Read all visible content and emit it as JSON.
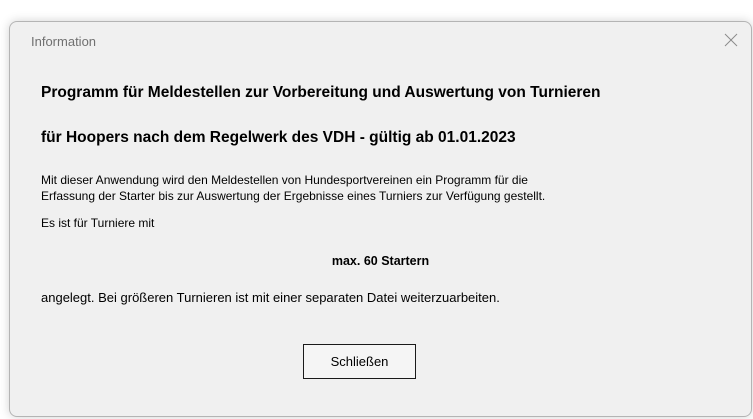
{
  "window": {
    "title": "Information",
    "close_icon": "close-icon"
  },
  "content": {
    "heading_line1": "Programm für Meldestellen zur Vorbereitung und Auswertung von Turnieren",
    "heading_line2": "für Hoopers nach dem Regelwerk des VDH - gültig ab 01.01.2023",
    "paragraph1_line1": "Mit dieser Anwendung wird den Meldestellen von Hundesportvereinen ein Programm für die",
    "paragraph1_line2": "Erfassung der Starter bis zur Auswertung der Ergebnisse eines Turniers zur Verfügung gestellt.",
    "paragraph2": "Es ist für Turniere mit",
    "max_starters": "max. 60 Startern",
    "paragraph3": "angelegt. Bei größeren Turnieren ist mit einer separaten Datei weiterzuarbeiten."
  },
  "buttons": {
    "close_label": "Schließen"
  },
  "colors": {
    "dialog_background": "#f0f0f0",
    "title_text": "#707070",
    "border": "#b4b4b4"
  }
}
